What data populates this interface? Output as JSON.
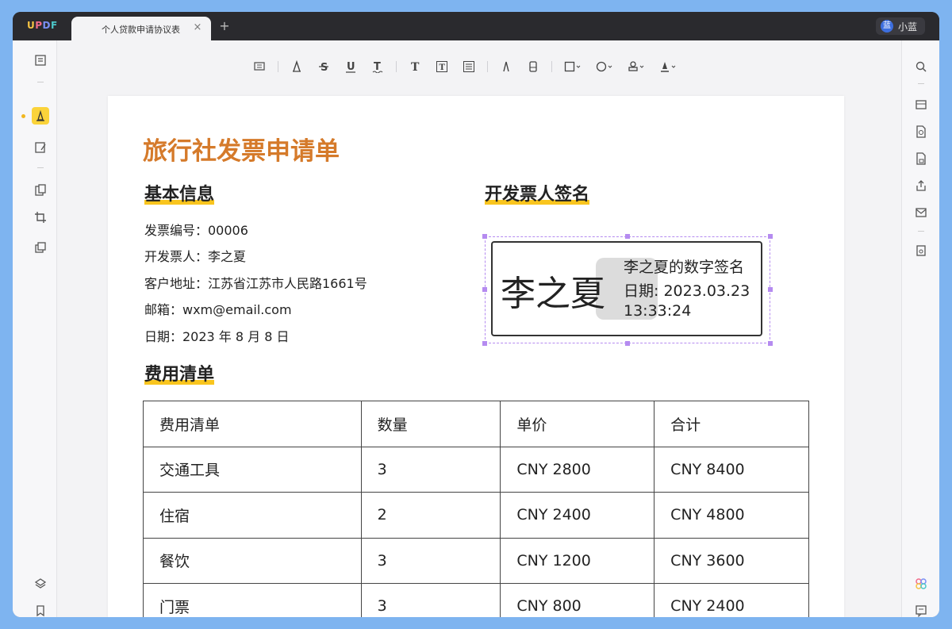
{
  "app": {
    "logo": [
      "U",
      "P",
      "D",
      "F"
    ],
    "tab_title": "个人贷款申请协议表",
    "tab_close": "×",
    "tab_add": "+",
    "user_avatar": "蓝",
    "user_name": "小蓝"
  },
  "toolbar": {
    "tools": [
      "comment-icon",
      "pencil-icon",
      "strikethrough-icon",
      "underline-icon",
      "squiggly-icon",
      "text-icon",
      "textbox-icon",
      "callout-icon",
      "pen-icon",
      "eraser-icon",
      "shape-icon",
      "sticker-icon",
      "stamp-icon",
      "signature-icon"
    ]
  },
  "document": {
    "title": "旅行社发票申请单",
    "sections": {
      "basic_info": "基本信息",
      "signature": "开发票人签名",
      "fee_list": "费用清单"
    },
    "info": [
      "发票编号：00006",
      "开发票人：李之夏",
      "客户地址：江苏省江苏市人民路1661号",
      "邮箱：wxm@email.com",
      "日期：2023 年 8 月 8 日"
    ],
    "signature": {
      "name": "李之夏",
      "line1": "李之夏的数字签名",
      "line2": "日期: 2023.03.23",
      "line3": "13:33:24"
    },
    "table": {
      "headers": [
        "费用清单",
        "数量",
        "单价",
        "合计"
      ],
      "rows": [
        [
          "交通工具",
          "3",
          "CNY 2800",
          "CNY 8400"
        ],
        [
          "住宿",
          "2",
          "CNY 2400",
          "CNY 4800"
        ],
        [
          "餐饮",
          "3",
          "CNY 1200",
          "CNY 3600"
        ],
        [
          "门票",
          "3",
          "CNY 800",
          "CNY 2400"
        ]
      ]
    }
  },
  "colors": {
    "title": "#d57a2a",
    "highlight": "#f9c51e",
    "selection": "#b58bf0",
    "accent": "#fbd33a"
  }
}
